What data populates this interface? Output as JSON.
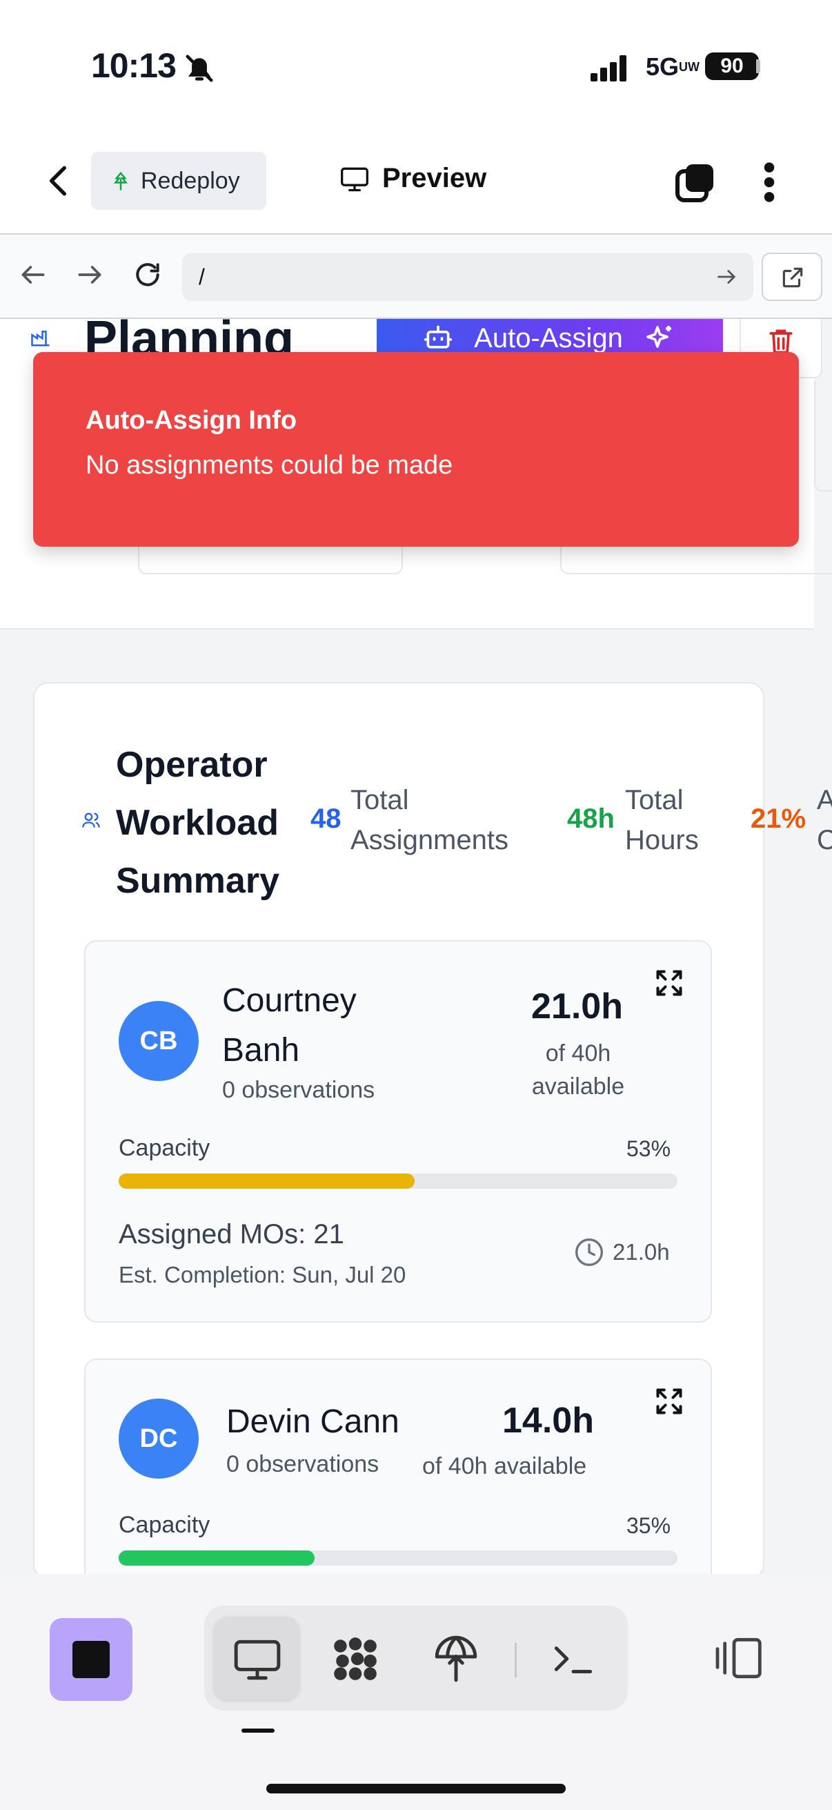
{
  "status_bar": {
    "time": "10:13",
    "network": "5G",
    "network_sup": "UW",
    "battery": "90"
  },
  "app_header": {
    "redeploy_label": "Redeploy",
    "preview_label": "Preview"
  },
  "browser": {
    "url": "/"
  },
  "page": {
    "title": "Planning",
    "auto_assign_label": "Auto-Assign"
  },
  "toast": {
    "title": "Auto-Assign Info",
    "message": "No assignments could be made",
    "color": "#ef4444"
  },
  "summary": {
    "title": "Operator Workload Summary",
    "stats": [
      {
        "value": "48",
        "label": "Total Assignments",
        "color": "#2563eb"
      },
      {
        "value": "48h",
        "label": "Total Hours",
        "color": "#16a34a"
      },
      {
        "value": "21%",
        "label": "A C",
        "color": "#ea580c"
      }
    ]
  },
  "operators": [
    {
      "initials": "CB",
      "name": "Courtney Banh",
      "observations": "0 observations",
      "hours": "21.0h",
      "available": "of 40h available",
      "capacity_label": "Capacity",
      "capacity_pct": "53%",
      "capacity_value": 0.53,
      "bar_color": "#eab308",
      "assigned": "Assigned MOs: 21",
      "est_completion": "Est. Completion: Sun, Jul 20",
      "time": "21.0h"
    },
    {
      "initials": "DC",
      "name": "Devin Cann",
      "observations": "0 observations",
      "hours": "14.0h",
      "available": "of 40h available",
      "capacity_label": "Capacity",
      "capacity_pct": "35%",
      "capacity_value": 0.35,
      "bar_color": "#22c55e"
    }
  ],
  "icons": {
    "bell": "bell-slash-icon",
    "back": "chevron-left-icon",
    "redeploy": "tree-icon",
    "preview": "monitor-icon",
    "tabs": "tabs-icon",
    "more": "more-vertical-icon",
    "expand": "expand-icon",
    "clock": "clock-icon",
    "terminal": "terminal-icon"
  }
}
